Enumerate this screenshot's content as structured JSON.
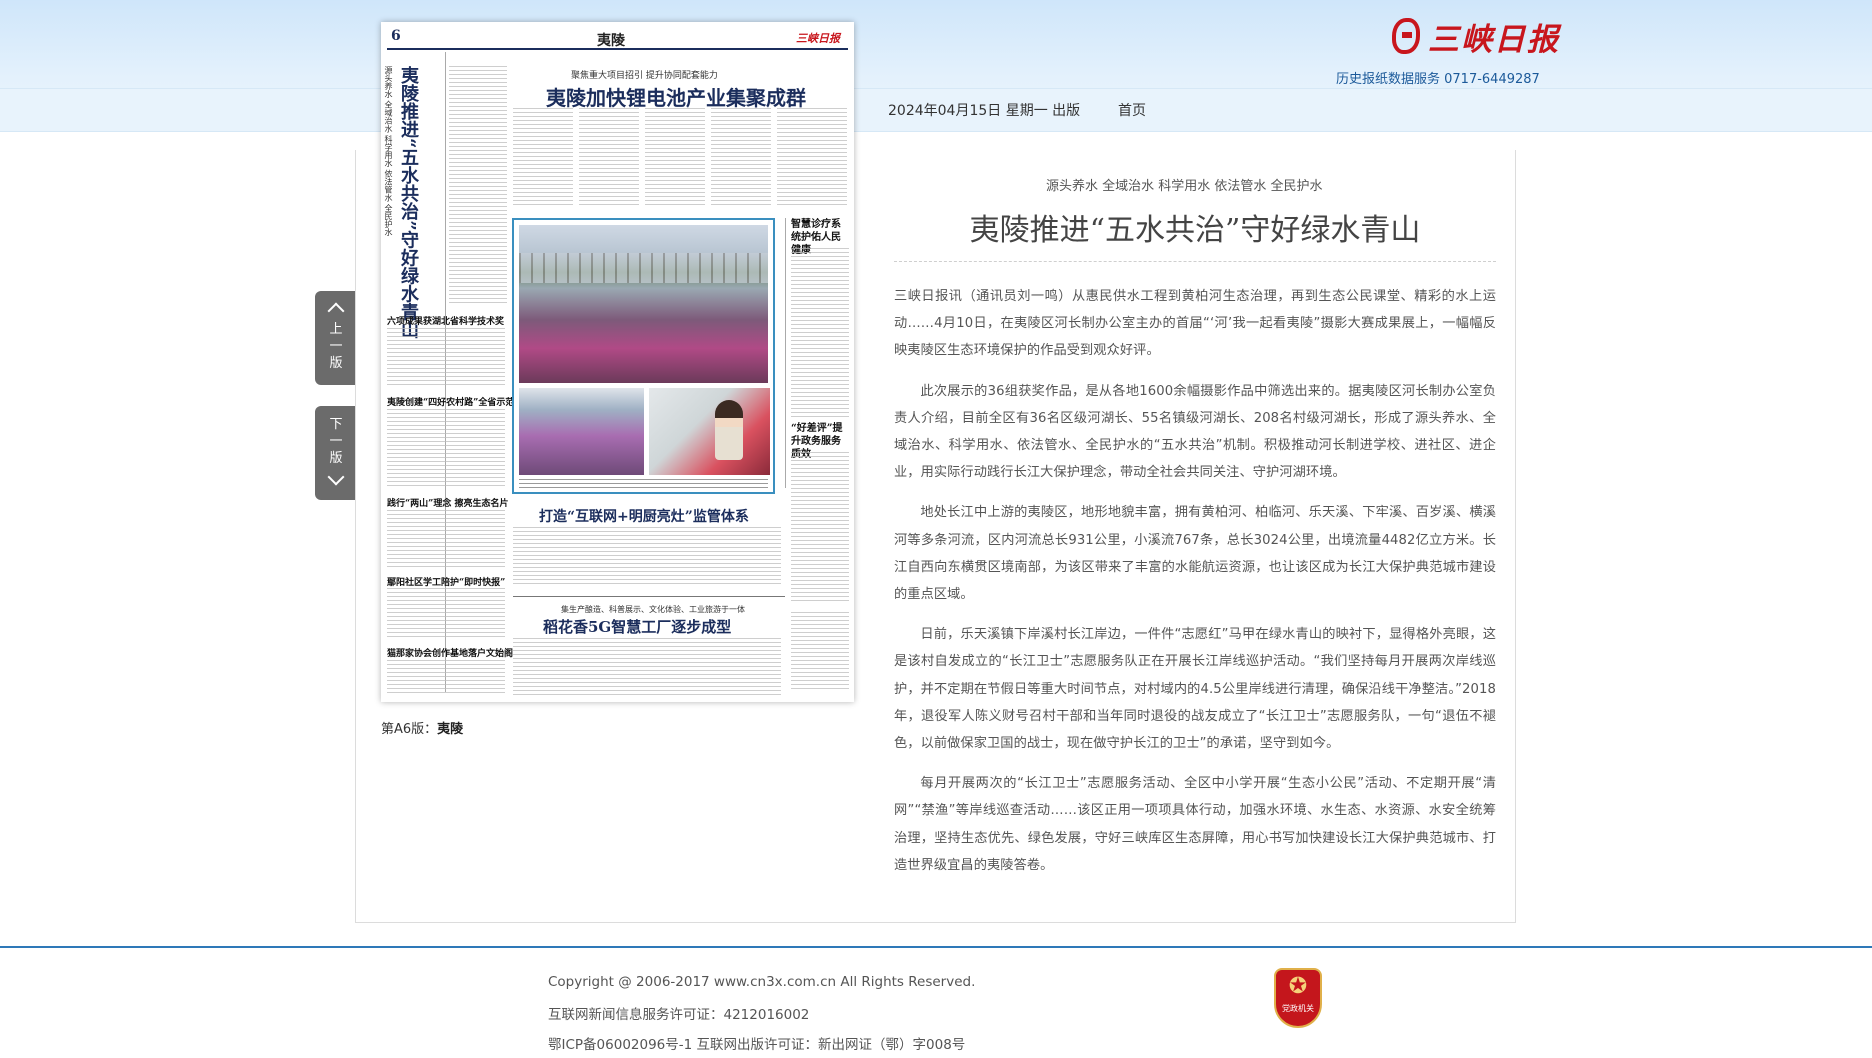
{
  "header": {
    "logo_text": "三峡日报",
    "hotline": "历史报纸数据服务  0717-6449287",
    "issue_date": "2024年04月15日  星期一  出版",
    "home_link": "首页"
  },
  "pager": {
    "prev": [
      "上",
      "一",
      "版"
    ],
    "next": [
      "下",
      "一",
      "版"
    ]
  },
  "newspaper_page": {
    "page_number": "6",
    "section_name": "夷陵",
    "masthead_mini": "三峡日报",
    "kicker": "聚焦重大项目招引  提升协同配套能力",
    "lead_headline": "夷陵加快锂电池产业集聚成群",
    "vertical_headline": "夷陵推进“五水共治”守好绿水青山",
    "vertical_subhead": "源头养水 全域治水 科学用水 依法管水 全民护水",
    "small_headlines": [
      "六项成果获湖北省科学技术奖",
      "夷陵创建“四好农村路”全省示范县",
      "践行“两山”理念 擦亮生态名片",
      "鄢阳社区学工陪护“即时快报”",
      "猫那家协会创作基地落户文始阁"
    ],
    "side_headline_1": "智慧诊疗系统护佑人民健康",
    "side_headline_2": "“好差评”提升政务服务质效",
    "mid_headline": "打造“互联网+明厨亮灶”监管体系",
    "bottom_kicker": "集生产酿造、科普展示、文化体验、工业旅游于一体",
    "bottom_headline": "稻花香5G智慧工厂逐步成型",
    "caption_label": "第A6版：",
    "caption_section": "夷陵"
  },
  "article": {
    "subtitle": "源头养水 全域治水 科学用水 依法管水 全民护水",
    "title": "夷陵推进“五水共治”守好绿水青山",
    "paragraphs": [
      "三峡日报讯（通讯员刘一鸣）从惠民供水工程到黄柏河生态治理，再到生态公民课堂、精彩的水上运动……4月10日，在夷陵区河长制办公室主办的首届“‘河’我一起看夷陵”摄影大赛成果展上，一幅幅反映夷陵区生态环境保护的作品受到观众好评。",
      "此次展示的36组获奖作品，是从各地1600余幅摄影作品中筛选出来的。据夷陵区河长制办公室负责人介绍，目前全区有36名区级河湖长、55名镇级河湖长、208名村级河湖长，形成了源头养水、全域治水、科学用水、依法管水、全民护水的“五水共治”机制。积极推动河长制进学校、进社区、进企业，用实际行动践行长江大保护理念，带动全社会共同关注、守护河湖环境。",
      "地处长江中上游的夷陵区，地形地貌丰富，拥有黄柏河、柏临河、乐天溪、下牢溪、百岁溪、横溪河等多条河流，区内河流总长931公里，小溪流767条，总长3024公里，出境流量4482亿立方米。长江自西向东横贯区境南部，为该区带来了丰富的水能航运资源，也让该区成为长江大保护典范城市建设的重点区域。",
      "日前，乐天溪镇下岸溪村长江岸边，一件件“志愿红”马甲在绿水青山的映衬下，显得格外亮眼，这是该村自发成立的“长江卫士”志愿服务队正在开展长江岸线巡护活动。“我们坚持每月开展两次岸线巡护，并不定期在节假日等重大时间节点，对村域内的4.5公里岸线进行清理，确保沿线干净整洁。”2018年，退役军人陈义财号召村干部和当年同时退役的战友成立了“长江卫士”志愿服务队，一句“退伍不褪色，以前做保家卫国的战士，现在做守护长江的卫士”的承诺，坚守到如今。",
      "每月开展两次的“长江卫士”志愿服务活动、全区中小学开展“生态小公民”活动、不定期开展“清网”“禁渔”等岸线巡查活动……该区正用一项项具体行动，加强水环境、水生态、水资源、水安全统筹治理，坚持生态优先、绿色发展，守好三峡库区生态屏障，用心书写加快建设长江大保护典范城市、打造世界级宜昌的夷陵答卷。"
    ]
  },
  "footer": {
    "copyright": "Copyright @ 2006-2017 www.cn3x.com.cn All Rights Reserved.",
    "license": "互联网新闻信息服务许可证：4212016002",
    "icp": "鄂ICP备06002096号-1 互联网出版许可证：新出网证（鄂）字008号",
    "badge_text": "党政机关"
  },
  "colors": {
    "accent_blue": "#2e78b8",
    "header_gradient_top": "#cfe6fa",
    "logo_red": "#c8161d",
    "pager_gray": "#6b6b6b"
  }
}
